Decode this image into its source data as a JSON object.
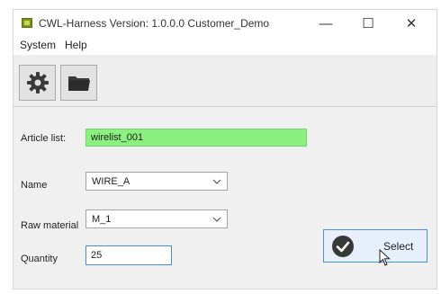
{
  "titlebar": {
    "title": "CWL-Harness  Version: 1.0.0.0  Customer_Demo",
    "minimize_glyph": "—",
    "maximize_glyph": "☐",
    "close_glyph": "✕"
  },
  "menu": {
    "items": [
      {
        "label": "System"
      },
      {
        "label": "Help"
      }
    ]
  },
  "toolbar": {
    "buttons": [
      {
        "icon": "gear-icon"
      },
      {
        "icon": "folder-icon"
      }
    ]
  },
  "form": {
    "article_list": {
      "label": "Article list:",
      "value": "wirelist_001"
    },
    "name": {
      "label": "Name",
      "value": "WIRE_A"
    },
    "raw_material": {
      "label": "Raw material",
      "value": "M_1"
    },
    "quantity": {
      "label": "Quantity",
      "value": "25"
    }
  },
  "select_button": {
    "label": "Select",
    "icon": "checkmark-icon"
  },
  "colors": {
    "article_field_bg": "#8af080",
    "focus_border": "#4a8fd4",
    "select_button_bg": "#e6effa"
  }
}
